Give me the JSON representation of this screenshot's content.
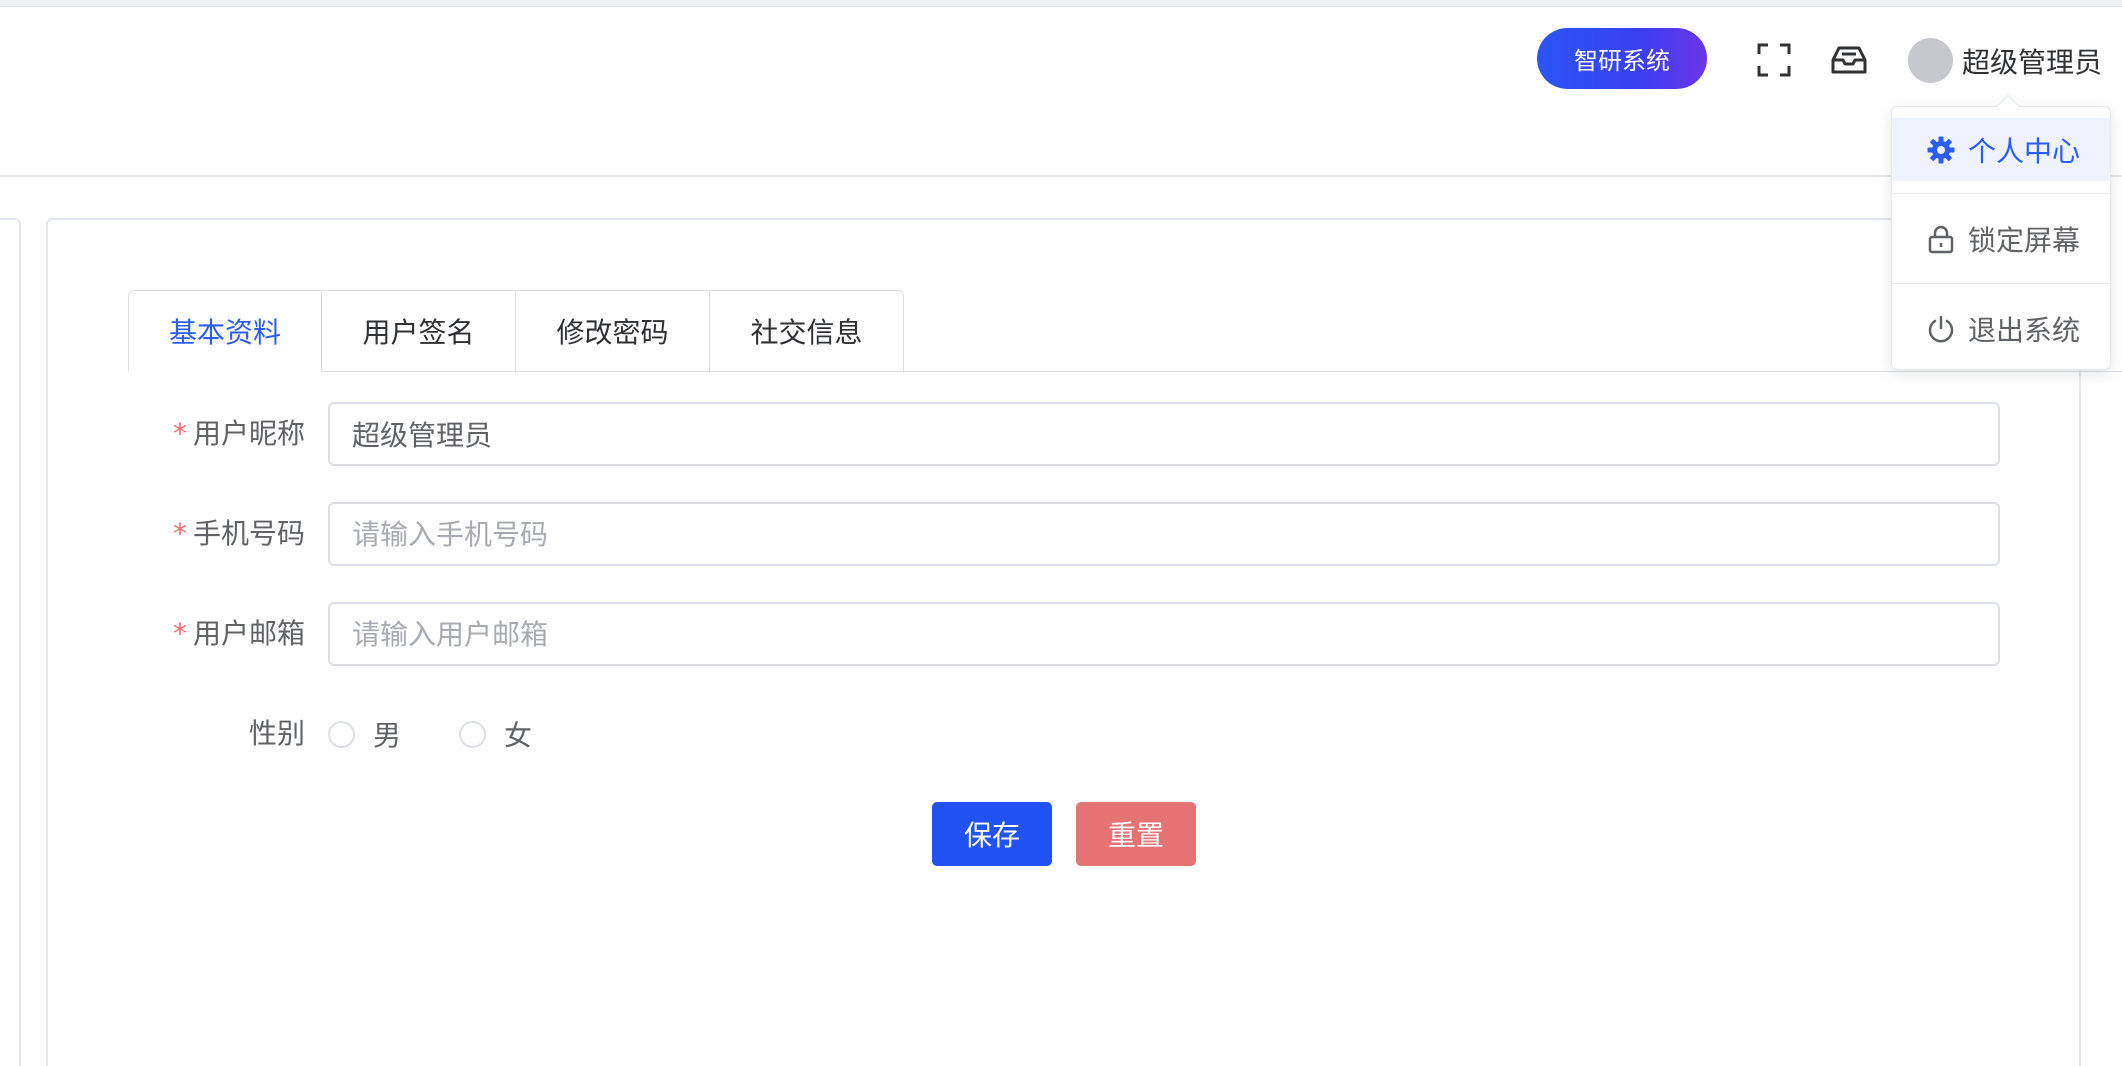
{
  "header": {
    "system_button": "智研系统",
    "user_name": "超级管理员",
    "icons": [
      "fullscreen-icon",
      "inbox-icon"
    ]
  },
  "user_menu": {
    "items": [
      {
        "label": "个人中心",
        "icon": "gear-icon",
        "active": true
      },
      {
        "label": "锁定屏幕",
        "icon": "lock-icon",
        "active": false
      },
      {
        "label": "退出系统",
        "icon": "power-icon",
        "active": false
      }
    ]
  },
  "tabs": [
    {
      "label": "基本资料",
      "active": true
    },
    {
      "label": "用户签名",
      "active": false
    },
    {
      "label": "修改密码",
      "active": false
    },
    {
      "label": "社交信息",
      "active": false
    }
  ],
  "form": {
    "nickname": {
      "label": "用户昵称",
      "required_mark": "*",
      "value": "超级管理员",
      "placeholder": ""
    },
    "phone": {
      "label": "手机号码",
      "required_mark": "*",
      "value": "",
      "placeholder": "请输入手机号码"
    },
    "email": {
      "label": "用户邮箱",
      "required_mark": "*",
      "value": "",
      "placeholder": "请输入用户邮箱"
    },
    "gender": {
      "label": "性别",
      "options": [
        "男",
        "女"
      ]
    }
  },
  "actions": {
    "save_label": "保存",
    "reset_label": "重置"
  },
  "colors": {
    "primary": "#2152f4",
    "danger": "#e57373",
    "active_text": "#2c5cf6",
    "required": "#f56c6c"
  }
}
